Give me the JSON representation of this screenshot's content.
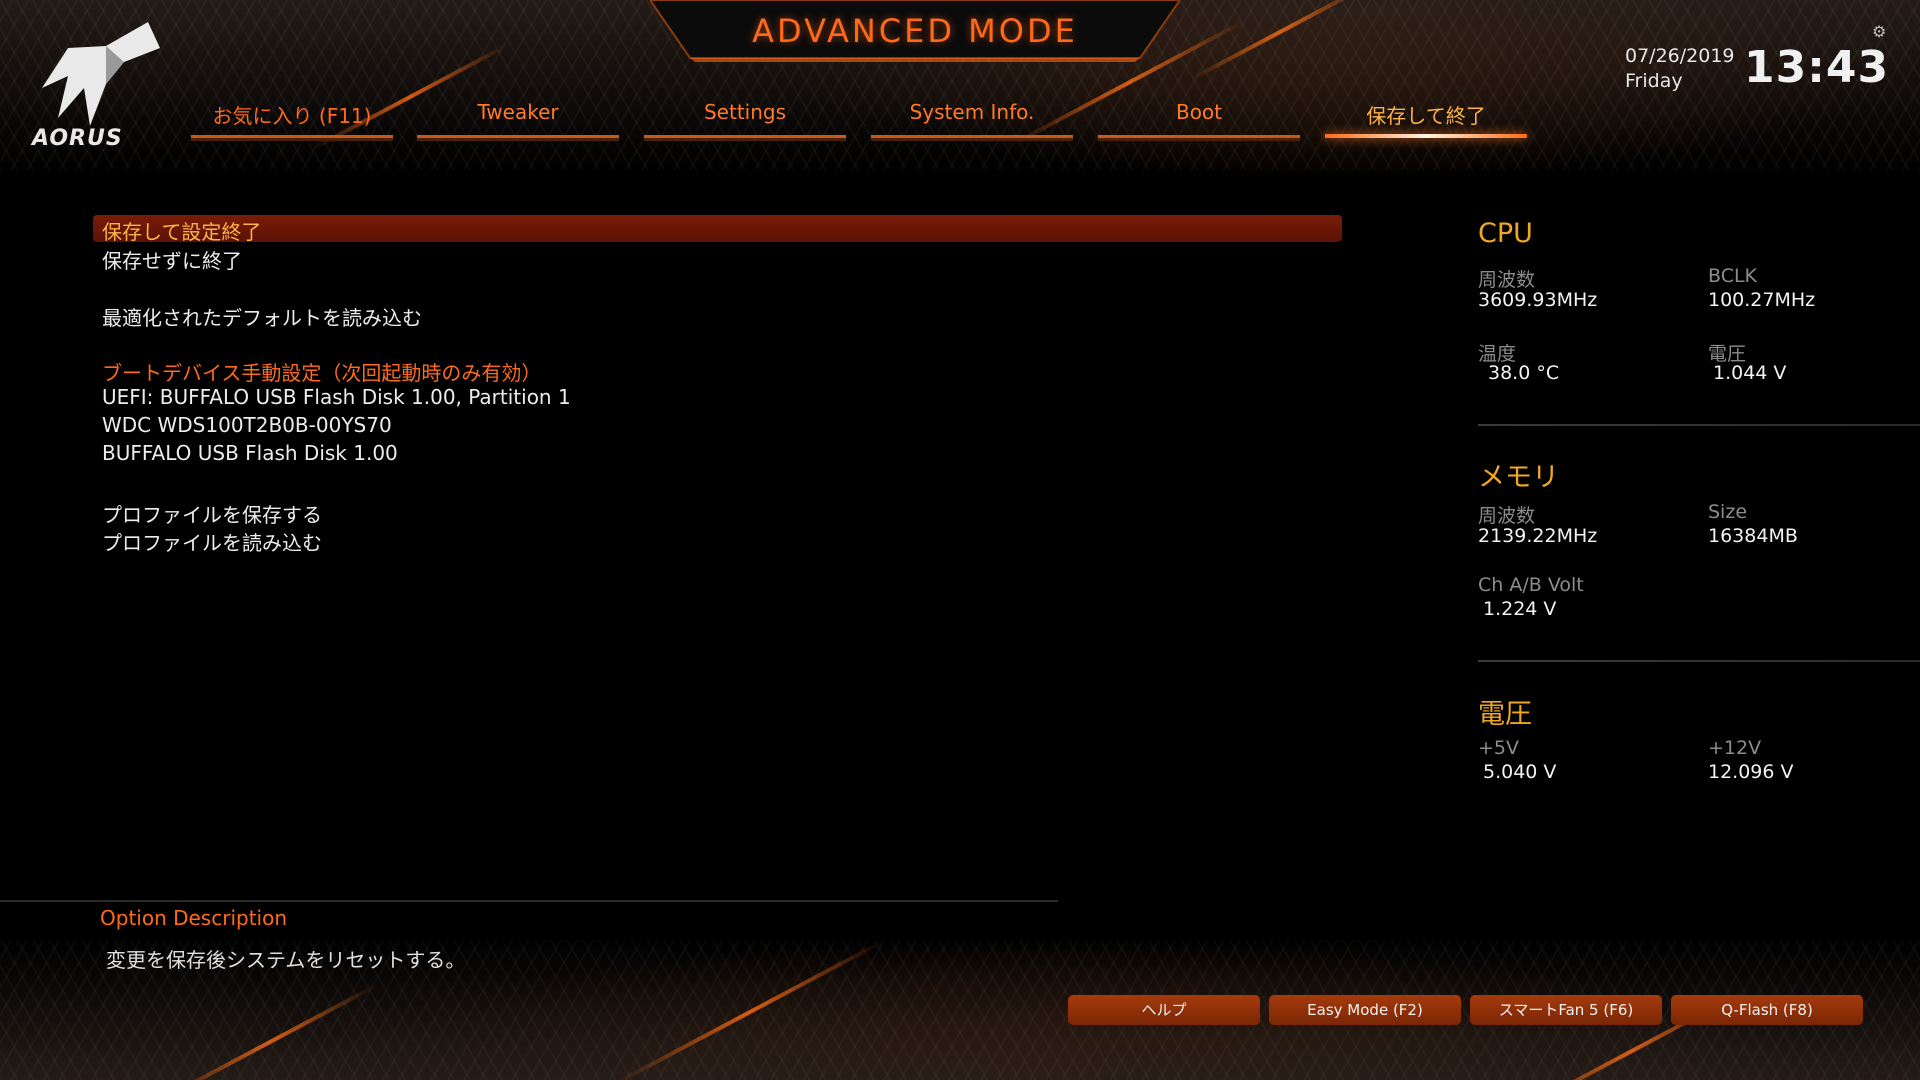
{
  "header": {
    "title": "ADVANCED MODE",
    "logo_text": "AORUS",
    "date": "07/26/2019",
    "weekday": "Friday",
    "time": "13:43",
    "accent_color": "#ff6a1a"
  },
  "tabs": [
    {
      "label": "お気に入り (F11)",
      "active": false
    },
    {
      "label": "Tweaker",
      "active": false
    },
    {
      "label": "Settings",
      "active": false
    },
    {
      "label": "System Info.",
      "active": false
    },
    {
      "label": "Boot",
      "active": false
    },
    {
      "label": "保存して終了",
      "active": true
    }
  ],
  "menu": {
    "save_exit": "保存して設定終了",
    "exit_no_save": "保存せずに終了",
    "load_defaults": "最適化されたデフォルトを読み込む",
    "boot_override_heading": "ブートデバイス手動設定（次回起動時のみ有効）",
    "boot_devices": [
      "UEFI: BUFFALO USB Flash Disk 1.00, Partition 1",
      "WDC  WDS100T2B0B-00YS70",
      "BUFFALO USB Flash Disk 1.00"
    ],
    "save_profile": "プロファイルを保存する",
    "load_profile": "プロファイルを読み込む"
  },
  "right_panel": {
    "cpu": {
      "heading": "CPU",
      "freq_label": "周波数",
      "freq_value": "3609.93MHz",
      "bclk_label": "BCLK",
      "bclk_value": "100.27MHz",
      "temp_label": "温度",
      "temp_value": "38.0 °C",
      "volt_label": "電圧",
      "volt_value": "1.044 V"
    },
    "memory": {
      "heading": "メモリ",
      "freq_label": "周波数",
      "freq_value": "2139.22MHz",
      "size_label": "Size",
      "size_value": "16384MB",
      "chvolt_label": "Ch A/B Volt",
      "chvolt_value": "1.224 V"
    },
    "voltage": {
      "heading": "電圧",
      "v5_label": "+5V",
      "v5_value": "5.040 V",
      "v12_label": "+12V",
      "v12_value": "12.096 V"
    }
  },
  "description": {
    "title": "Option Description",
    "text": "変更を保存後システムをリセットする。"
  },
  "buttons": {
    "help": "ヘルプ",
    "easy_mode": "Easy Mode (F2)",
    "smart_fan": "スマートFan 5 (F6)",
    "qflash": "Q-Flash (F8)"
  }
}
